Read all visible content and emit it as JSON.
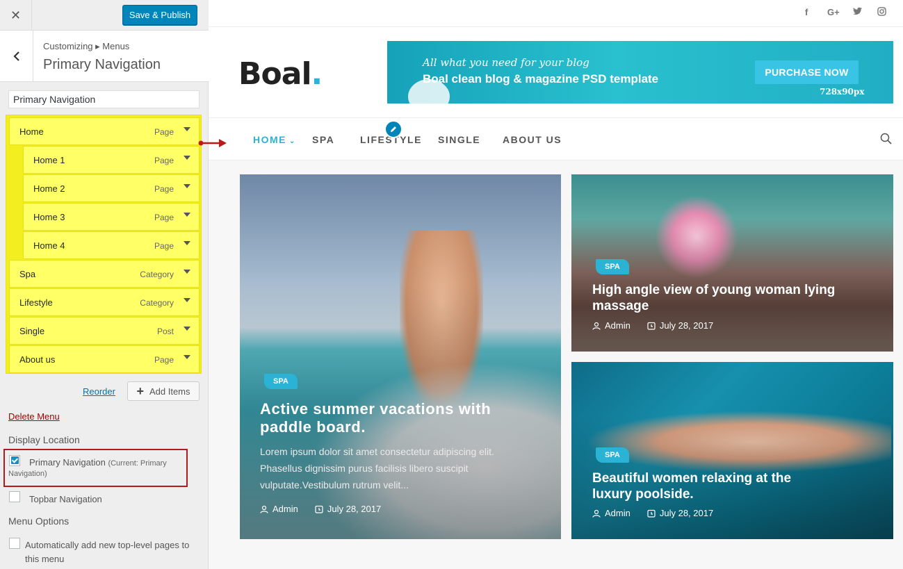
{
  "customizer": {
    "close_icon": "✕",
    "save_label": "Save & Publish",
    "breadcrumb": "Customizing ▸ Menus",
    "panel_title": "Primary Navigation",
    "menu_name_value": "Primary Navigation",
    "menu_items": [
      {
        "label": "Home",
        "type": "Page",
        "depth": 0
      },
      {
        "label": "Home 1",
        "type": "Page",
        "depth": 1
      },
      {
        "label": "Home 2",
        "type": "Page",
        "depth": 1
      },
      {
        "label": "Home 3",
        "type": "Page",
        "depth": 1
      },
      {
        "label": "Home 4",
        "type": "Page",
        "depth": 1
      },
      {
        "label": "Spa",
        "type": "Category",
        "depth": 0
      },
      {
        "label": "Lifestyle",
        "type": "Category",
        "depth": 0
      },
      {
        "label": "Single",
        "type": "Post",
        "depth": 0
      },
      {
        "label": "About us",
        "type": "Page",
        "depth": 0
      }
    ],
    "reorder_label": "Reorder",
    "add_items_label": "Add Items",
    "delete_menu_label": "Delete Menu",
    "display_location_heading": "Display Location",
    "locations": [
      {
        "label": "Primary Navigation",
        "note": "(Current: Primary Navigation)",
        "checked": true
      },
      {
        "label": "Topbar Navigation",
        "note": "",
        "checked": false
      }
    ],
    "menu_options_heading": "Menu Options",
    "auto_add_label": "Automatically add new top-level pages to this menu",
    "auto_add_checked": false,
    "highlight_color": "#ffff66",
    "accent_color": "#0085ba"
  },
  "preview": {
    "social_icons": [
      "facebook-icon",
      "google-plus-icon",
      "twitter-icon",
      "instagram-icon"
    ],
    "social_glyphs": [
      "f",
      "G+",
      "🐦",
      "◎"
    ],
    "logo_text": "Boal",
    "logo_dot": ".",
    "banner": {
      "tagline": "All what you need for your blog",
      "headline": "Boal clean blog & magazine PSD template",
      "button": "PURCHASE NOW",
      "size": "728x90px"
    },
    "nav": [
      "HOME",
      "SPA",
      "LIFESTYLE",
      "SINGLE",
      "ABOUT US"
    ],
    "nav_active": "HOME",
    "accent_color": "#2bb3d6",
    "posts": [
      {
        "category": "SPA",
        "title": "Active summer vacations with paddle board.",
        "excerpt": "Lorem ipsum dolor sit amet consectetur adipiscing elit. Phasellus dignissim purus facilisis libero suscipit vulputate.Vestibulum rutrum velit...",
        "author": "Admin",
        "date": "July 28, 2017"
      },
      {
        "category": "SPA",
        "title": "High angle view of young woman lying massage",
        "author": "Admin",
        "date": "July 28, 2017"
      },
      {
        "category": "SPA",
        "title": "Beautiful women relaxing at the luxury poolside.",
        "author": "Admin",
        "date": "July 28, 2017"
      }
    ]
  }
}
